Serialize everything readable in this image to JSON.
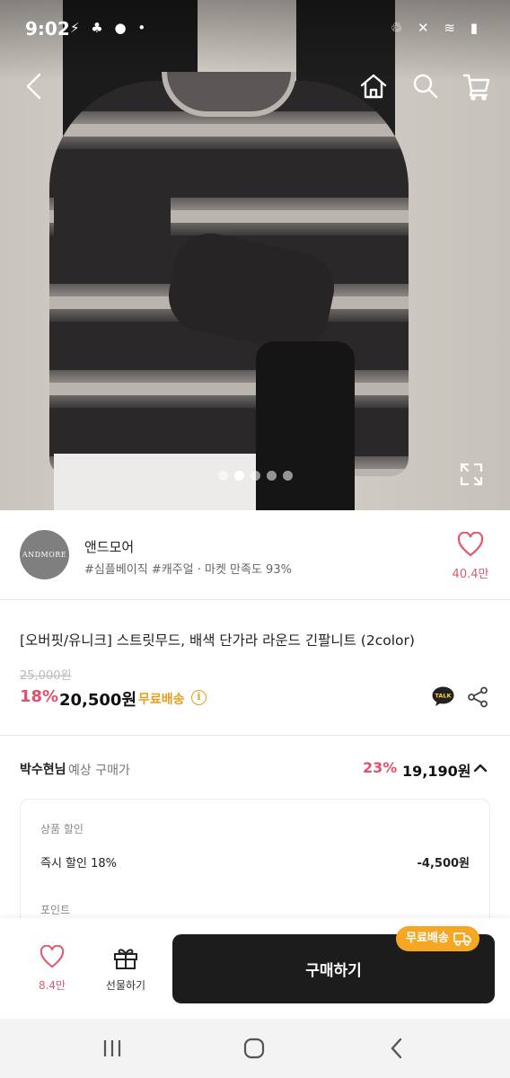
{
  "status_bar": {
    "time": "9:02",
    "left_icons": "⚡ ♣ ● •",
    "right_icons": "♲ ✕ ≋ ▮"
  },
  "store": {
    "logo_text": "ANDMORE",
    "name": "앤드모어",
    "tags": "#심플베이직 #캐주얼 · 마켓 만족도 93%",
    "like_count": "40.4만"
  },
  "product": {
    "title": "[오버핏/유니크] 스트릿무드, 배색 단가라 라운드 긴팔니트 (2color)",
    "original_price": "25,000원",
    "discount": "18%",
    "price": "20,500원",
    "free_shipping": "무료배송",
    "info_icon_label": "i",
    "talk_icon_label": "TALK"
  },
  "expected": {
    "user": "박수현님",
    "label": "예상 구매가",
    "discount": "23%",
    "price": "19,190원"
  },
  "detail": {
    "section_label": "상품 할인",
    "instant_label": "즉시 할인 18%",
    "instant_value": "-4,500원",
    "points_label": "포인트"
  },
  "bottom": {
    "like_count": "8.4만",
    "gift_label": "선물하기",
    "buy_label": "구매하기",
    "ship_badge": "무료배송"
  },
  "carousel": {
    "total": 5,
    "active_index": 1
  },
  "colors": {
    "accent_pink": "#e0526b",
    "free_ship_orange": "#e3a020",
    "buy_button": "#1c1c1c"
  }
}
